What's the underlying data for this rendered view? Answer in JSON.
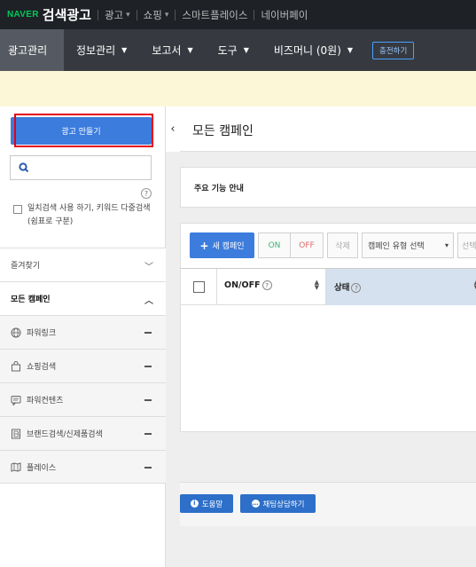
{
  "topbar": {
    "brand": "NAVER",
    "product": "검색광고",
    "links": [
      {
        "label": "광고",
        "has_dropdown": true
      },
      {
        "label": "쇼핑",
        "has_dropdown": true
      },
      {
        "label": "스마트플레이스",
        "has_dropdown": false
      },
      {
        "label": "네이버페이",
        "has_dropdown": false
      }
    ]
  },
  "mainnav": {
    "items": [
      {
        "label": "광고관리",
        "active": true
      },
      {
        "label": "정보관리"
      },
      {
        "label": "보고서"
      },
      {
        "label": "도구"
      },
      {
        "label": "비즈머니 (0원)"
      }
    ],
    "charge_label": "충전하기"
  },
  "sidebar": {
    "create_label": "광고 만들기",
    "search_placeholder": "",
    "exact_match_label": "일치검색 사용 하기, 키워드 다중검색(쉼표로 구분)",
    "help_glyph": "?",
    "favorites_label": "즐겨찾기",
    "all_campaigns_label": "모든 캠페인",
    "campaign_types": [
      {
        "label": "파워링크",
        "icon": "globe-icon"
      },
      {
        "label": "쇼핑검색",
        "icon": "shopping-bag-icon"
      },
      {
        "label": "파워컨텐츠",
        "icon": "content-icon"
      },
      {
        "label": "브랜드검색/신제품검색",
        "icon": "brand-icon"
      },
      {
        "label": "플레이스",
        "icon": "map-icon"
      }
    ]
  },
  "content": {
    "title": "모든 캠페인",
    "guide_label": "주요 기능 안내",
    "toolbar": {
      "new_campaign": "새 캠페인",
      "on": "ON",
      "off": "OFF",
      "delete": "삭제",
      "type_select": "캠페인 유형 선택",
      "more_select": "선택"
    },
    "table_headers": {
      "onoff": "ON/OFF",
      "status": "상태"
    },
    "footer": {
      "help_label": "도움말",
      "chat_label": "채팅상담하기"
    }
  },
  "colors": {
    "topbar_bg": "#1e2126",
    "nav_bg": "#363a40",
    "brand_green": "#03c75a",
    "primary_blue": "#3c7cdd",
    "highlight_red": "#e60012",
    "notice_bg": "#fcf8d7"
  }
}
